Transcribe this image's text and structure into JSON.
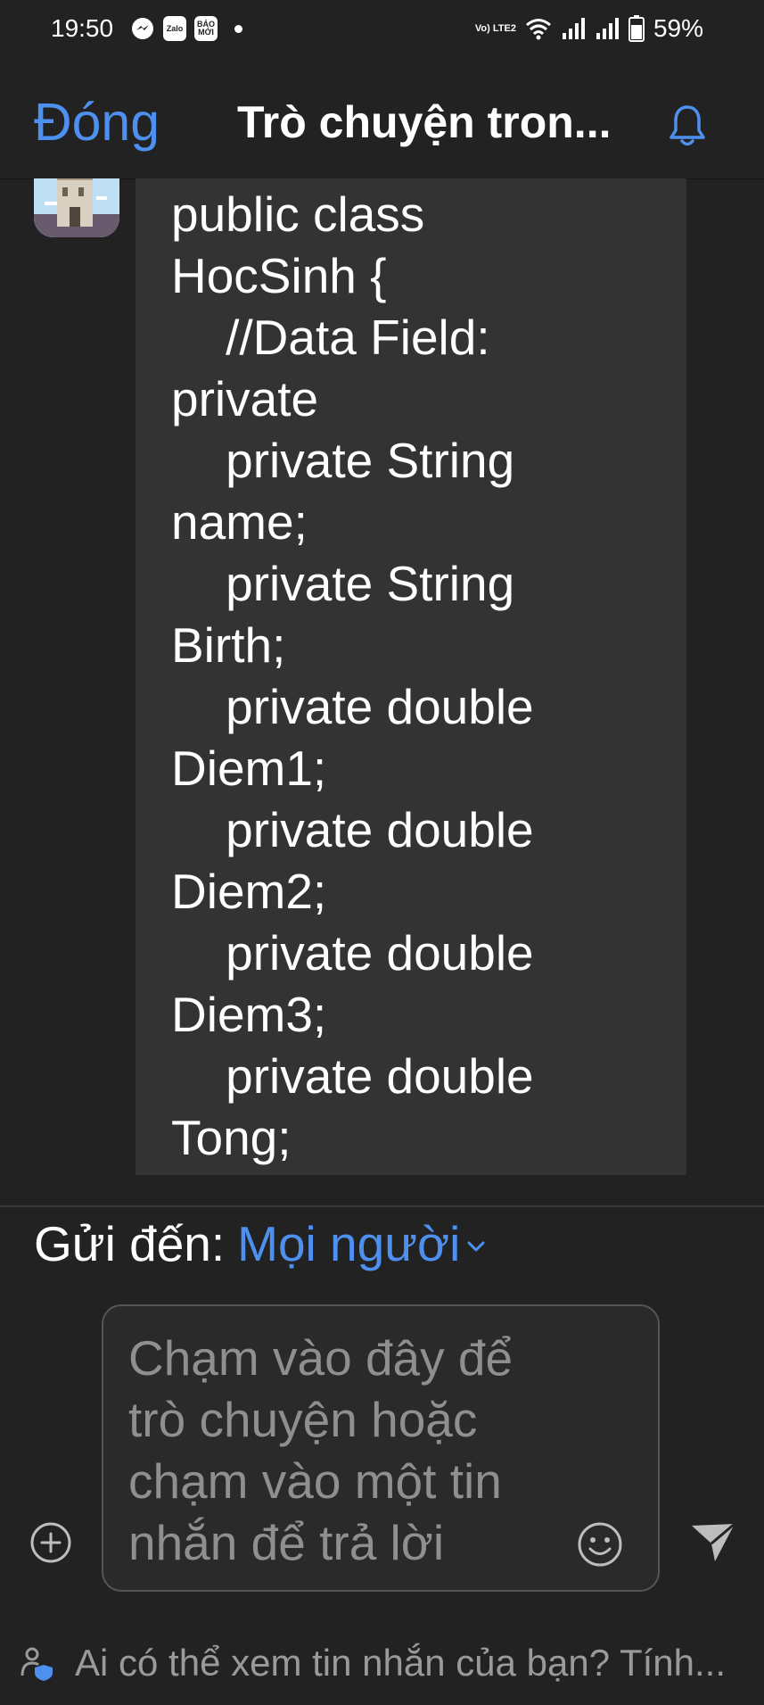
{
  "status_bar": {
    "time": "19:50",
    "apps": [
      "messenger-icon",
      "Zalo",
      "BÁO MỚI"
    ],
    "network_label": "Vo) LTE2",
    "battery": "59%"
  },
  "header": {
    "close_label": "Đóng",
    "title": "Trò chuyện tron...",
    "bell_icon": "bell-icon"
  },
  "message": {
    "lines": [
      "public class",
      "HocSinh {",
      "    //Data Field:",
      "private",
      "    private String",
      "name;",
      "    private String",
      "Birth;",
      "    private double",
      "Diem1;",
      "    private double",
      "Diem2;",
      "    private double",
      "Diem3;",
      "    private double",
      "Tong;"
    ]
  },
  "send_to": {
    "label": "Gửi đến:",
    "value": "Mọi người"
  },
  "composer": {
    "placeholder": "Chạm vào đây để trò chuyện hoặc chạm vào một tin nhắn để trả lời"
  },
  "privacy": {
    "text": "Ai có thể xem tin nhắn của bạn? Tính..."
  },
  "colors": {
    "accent": "#4e90f0",
    "background": "#222222",
    "bubble": "#333333"
  }
}
